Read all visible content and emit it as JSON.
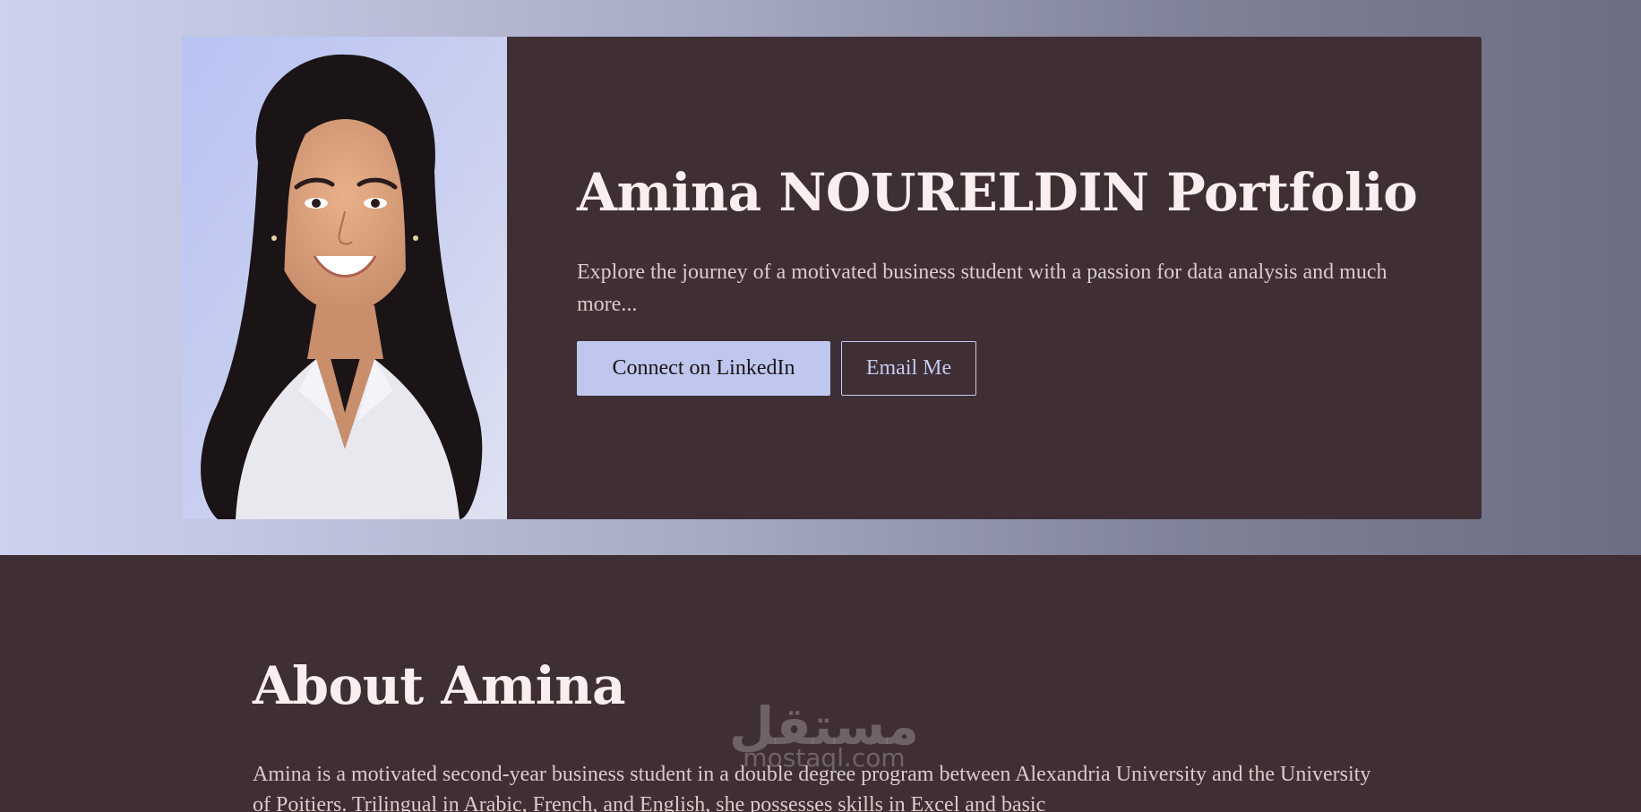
{
  "hero": {
    "title": "Amina NOURELDIN Portfolio",
    "description": "Explore the journey of a motivated business student with a passion for data analysis and much more...",
    "linkedin_button": "Connect on LinkedIn",
    "email_button": "Email Me"
  },
  "about": {
    "title": "About Amina",
    "text": "Amina is a motivated second-year business student in a double degree program between Alexandria University and the University of Poitiers. Trilingual in Arabic, French, and English, she possesses skills in Excel and basic"
  },
  "watermark": {
    "arabic": "مستقل",
    "latin": "mostaql.com"
  },
  "colors": {
    "card_background": "#3f2f34",
    "accent": "#bfc7ee",
    "heading": "#fbeeee",
    "body_text": "#d9cccc"
  }
}
